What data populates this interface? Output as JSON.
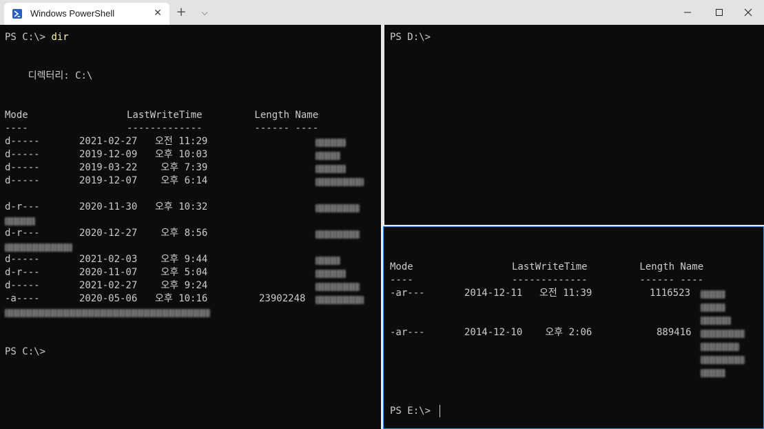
{
  "window": {
    "tab_title": "Windows PowerShell",
    "tab_icon": "powershell-icon",
    "close_tab_glyph": "✕",
    "new_tab_glyph": "+",
    "dropdown_glyph": "⌵",
    "controls": [
      "minimize-icon",
      "maximize-icon",
      "close-icon"
    ]
  },
  "left_pane": {
    "prompt1": "PS C:\\> ",
    "command": "dir",
    "directory_line": "    디렉터리: C:\\",
    "header": "Mode                 LastWriteTime         Length Name",
    "underline": "----                 -------------         ------ ----",
    "rows": [
      {
        "mode": "d-----",
        "date": "2021-02-27",
        "time": "오전 11:29",
        "length": ""
      },
      {
        "mode": "d-----",
        "date": "2019-12-09",
        "time": "오후 10:03",
        "length": ""
      },
      {
        "mode": "d-----",
        "date": "2019-03-22",
        "time": " 오후 7:39",
        "length": ""
      },
      {
        "mode": "d-----",
        "date": "2019-12-07",
        "time": " 오후 6:14",
        "length": ""
      },
      {
        "mode": "d-r---",
        "date": "2020-11-30",
        "time": "오후 10:32",
        "length": ""
      },
      {
        "mode": "d-r---",
        "date": "2020-12-27",
        "time": " 오후 8:56",
        "length": ""
      },
      {
        "mode": "d-----",
        "date": "2021-02-03",
        "time": " 오후 9:44",
        "length": ""
      },
      {
        "mode": "d-r---",
        "date": "2020-11-07",
        "time": " 오후 5:04",
        "length": ""
      },
      {
        "mode": "d-----",
        "date": "2021-02-27",
        "time": " 오후 9:24",
        "length": ""
      },
      {
        "mode": "-a----",
        "date": "2020-05-06",
        "time": "오후 10:16",
        "length": "23902248"
      }
    ],
    "prompt2": "PS C:\\>"
  },
  "right_top_pane": {
    "prompt": "PS D:\\>"
  },
  "right_bottom_pane": {
    "header": "Mode                 LastWriteTime         Length Name",
    "underline": "----                 -------------         ------ ----",
    "rows": [
      {
        "mode": "-ar---",
        "date": "2014-12-11",
        "time": "오전 11:39",
        "length": "1116523"
      },
      {
        "mode": "-ar---",
        "date": "2014-12-10",
        "time": " 오후 2:06",
        "length": "889416"
      }
    ],
    "prompt": "PS E:\\> "
  },
  "colors": {
    "background": "#0c0c0c",
    "text": "#cccccc",
    "command": "#f9f1a5",
    "focus_border": "#3b8ed8"
  }
}
